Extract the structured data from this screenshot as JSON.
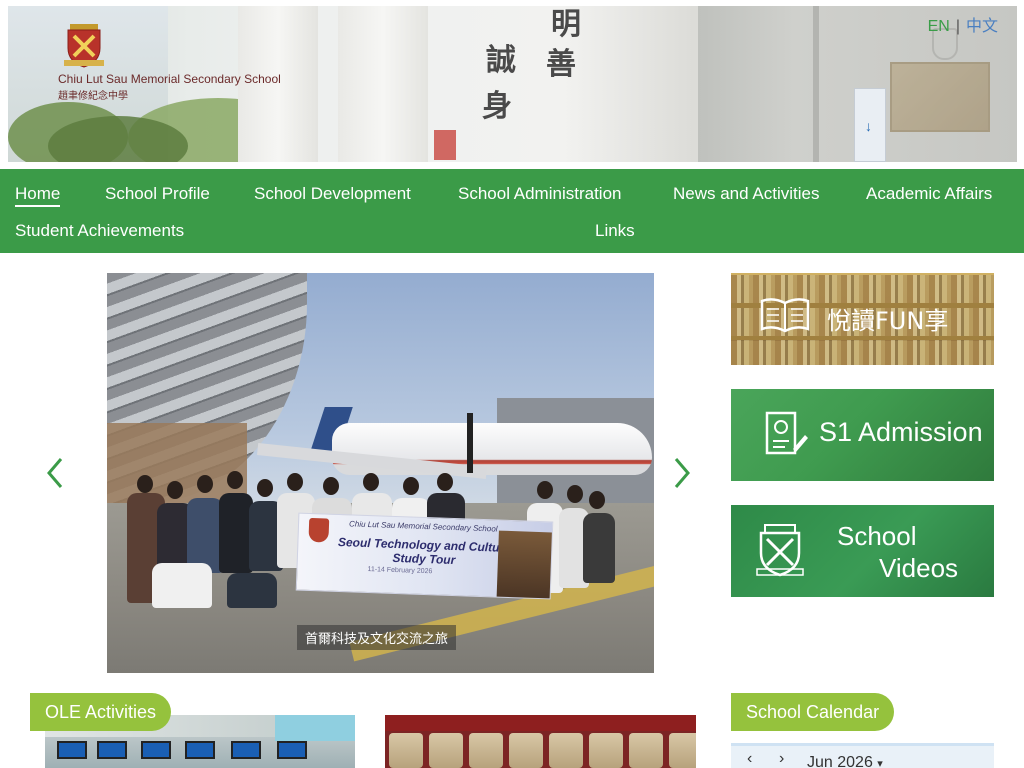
{
  "header": {
    "school_name_en": "Chiu Lut Sau Memorial Secondary School",
    "school_name_zh": "趙聿修紀念中學",
    "inscription": [
      "明",
      "善",
      "誠",
      "身"
    ],
    "lang": {
      "en": "EN",
      "separator": "|",
      "zh": "中文"
    }
  },
  "nav": {
    "items": [
      {
        "label": "Home",
        "active": true
      },
      {
        "label": "School Profile"
      },
      {
        "label": "School Development"
      },
      {
        "label": "School Administration"
      },
      {
        "label": "News and Activities"
      },
      {
        "label": "Academic Affairs"
      },
      {
        "label": "Student Achievements"
      },
      {
        "label": "Links"
      }
    ]
  },
  "slider": {
    "caption": "首爾科技及文化交流之旅",
    "banner_school": "Chiu Lut Sau Memorial Secondary School",
    "banner_title": "Seoul Technology and Culture Study Tour",
    "banner_dates": "11-14 February 2026"
  },
  "promos": {
    "reading": {
      "label": "悅讀FUN享",
      "icon": "book-icon"
    },
    "admission": {
      "label": "S1 Admission",
      "icon": "application-form-icon"
    },
    "videos": {
      "label_line1": "School",
      "label_line2": "Videos",
      "icon": "school-crest-icon"
    }
  },
  "sections": {
    "ole": "OLE Activities",
    "calendar": "School Calendar"
  },
  "calendar": {
    "prev": "‹",
    "next": "›",
    "month": "Jun 2026",
    "dropdown": "▾"
  },
  "colors": {
    "nav_green": "#3b9b48",
    "pill_green": "#95c23d",
    "lang_en": "#3a9d48",
    "lang_zh": "#4a7fc1"
  }
}
